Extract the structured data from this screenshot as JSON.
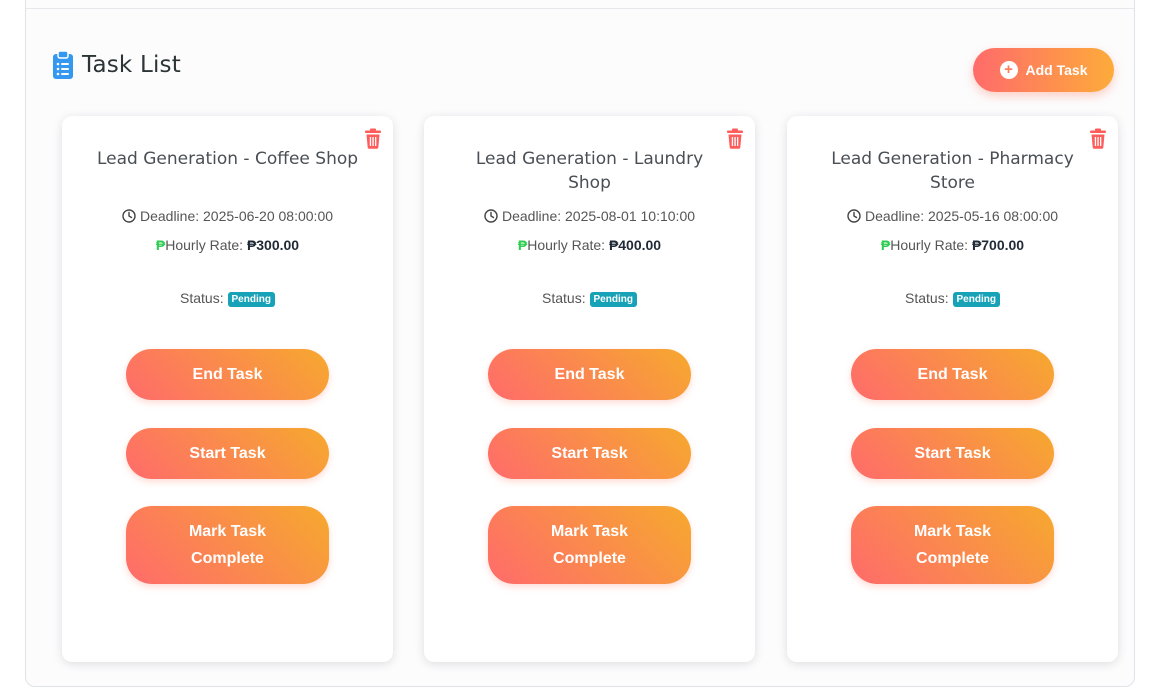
{
  "header": {
    "title": "Task List",
    "add_button_label": "Add Task"
  },
  "common": {
    "deadline_prefix": "Deadline: ",
    "rate_prefix": "Hourly Rate: ",
    "peso_symbol": "₱",
    "status_label": "Status: ",
    "end_label": "End Task",
    "start_label": "Start Task",
    "complete_label": "Mark Task Complete"
  },
  "tasks": [
    {
      "title": "Lead Generation - Coffee Shop",
      "deadline": "2025-06-20 08:00:00",
      "rate": "₱300.00",
      "status": "Pending"
    },
    {
      "title": "Lead Generation - Laundry Shop",
      "deadline": "2025-08-01 10:10:00",
      "rate": "₱400.00",
      "status": "Pending"
    },
    {
      "title": "Lead Generation - Pharmacy Store",
      "deadline": "2025-05-16 08:00:00",
      "rate": "₱700.00",
      "status": "Pending"
    }
  ],
  "colors": {
    "accent_start": "#ff6b6b",
    "accent_end": "#fdab3a",
    "badge": "#17a2b8",
    "delete": "#ff5c5c",
    "peso": "#2ecc52",
    "title_icon": "#3498f0"
  }
}
